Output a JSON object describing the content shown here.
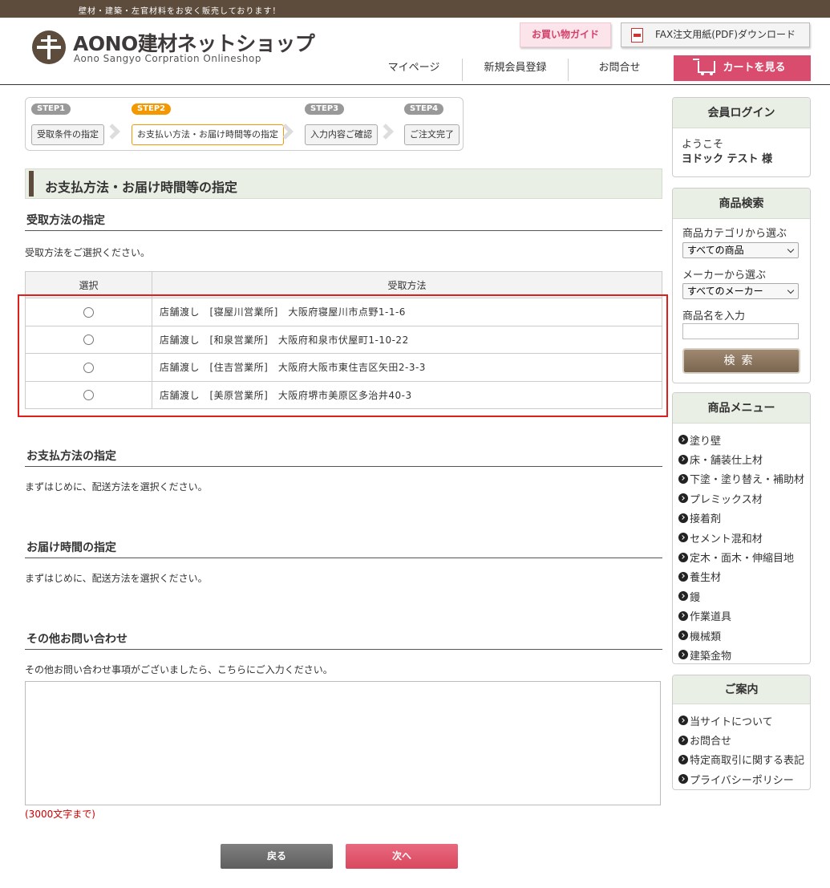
{
  "topbar": {
    "tagline": "壁材・建築・左官材料をお安く販売しております！"
  },
  "header": {
    "logo_title": "AONO建材ネットショップ",
    "logo_subtitle": "Aono Sangyo  Corpration  Onlineshop",
    "guide_label": "お買い物ガイド",
    "fax_label": "FAX注文用紙(PDF)ダウンロード",
    "nav": {
      "mypage": "マイページ",
      "register": "新規会員登録",
      "contact": "お問合せ",
      "cart": "カートを見る"
    }
  },
  "steps": [
    {
      "tag": "STEP1",
      "label": "受取条件の指定",
      "active": false
    },
    {
      "tag": "STEP2",
      "label": "お支払い方法・お届け時間等の指定",
      "active": true
    },
    {
      "tag": "STEP3",
      "label": "入力内容ご確認",
      "active": false
    },
    {
      "tag": "STEP4",
      "label": "ご注文完了",
      "active": false
    }
  ],
  "main": {
    "page_title": "お支払方法・お届け時間等の指定",
    "receive": {
      "title": "受取方法の指定",
      "desc": "受取方法をご選択ください。",
      "col_select": "選択",
      "col_method": "受取方法",
      "rows": [
        "店舗渡し　[寝屋川営業所]　大阪府寝屋川市点野1-1-6",
        "店舗渡し　[和泉営業所]　大阪府和泉市伏屋町1-10-22",
        "店舗渡し　[住吉営業所]　大阪府大阪市東住吉区矢田2-3-3",
        "店舗渡し　[美原営業所]　大阪府堺市美原区多治井40-3"
      ]
    },
    "payment": {
      "title": "お支払方法の指定",
      "desc": "まずはじめに、配送方法を選択ください。"
    },
    "delivery_time": {
      "title": "お届け時間の指定",
      "desc": "まずはじめに、配送方法を選択ください。"
    },
    "other": {
      "title": "その他お問い合わせ",
      "desc": "その他お問い合わせ事項がございましたら、こちらにご入力ください。",
      "textarea_value": "",
      "limit": "(3000文字まで)"
    },
    "back_label": "戻る",
    "next_label": "次へ"
  },
  "sidebar": {
    "login": {
      "title": "会員ログイン",
      "welcome": "ようこそ",
      "user": "ヨドック テスト 様"
    },
    "search": {
      "title": "商品検索",
      "category_label": "商品カテゴリから選ぶ",
      "category_value": "すべての商品",
      "maker_label": "メーカーから選ぶ",
      "maker_value": "すべてのメーカー",
      "name_label": "商品名を入力",
      "name_value": "",
      "button": "検索"
    },
    "menu": {
      "title": "商品メニュー",
      "items": [
        "塗り壁",
        "床・舗装仕上材",
        "下塗・塗り替え・補助材",
        "プレミックス材",
        "接着剤",
        "セメント混和材",
        "定木・面木・伸縮目地",
        "養生材",
        "鏝",
        "作業道具",
        "機械類",
        "建築金物"
      ]
    },
    "guide": {
      "title": "ご案内",
      "items": [
        "当サイトについて",
        "お問合せ",
        "特定商取引に関する表記",
        "プライバシーポリシー"
      ]
    }
  },
  "colors": {
    "brand_brown": "#5d4b3c",
    "accent_pink": "#d94c6e",
    "step_active": "#f39800",
    "highlight_red": "#e01e1e"
  }
}
